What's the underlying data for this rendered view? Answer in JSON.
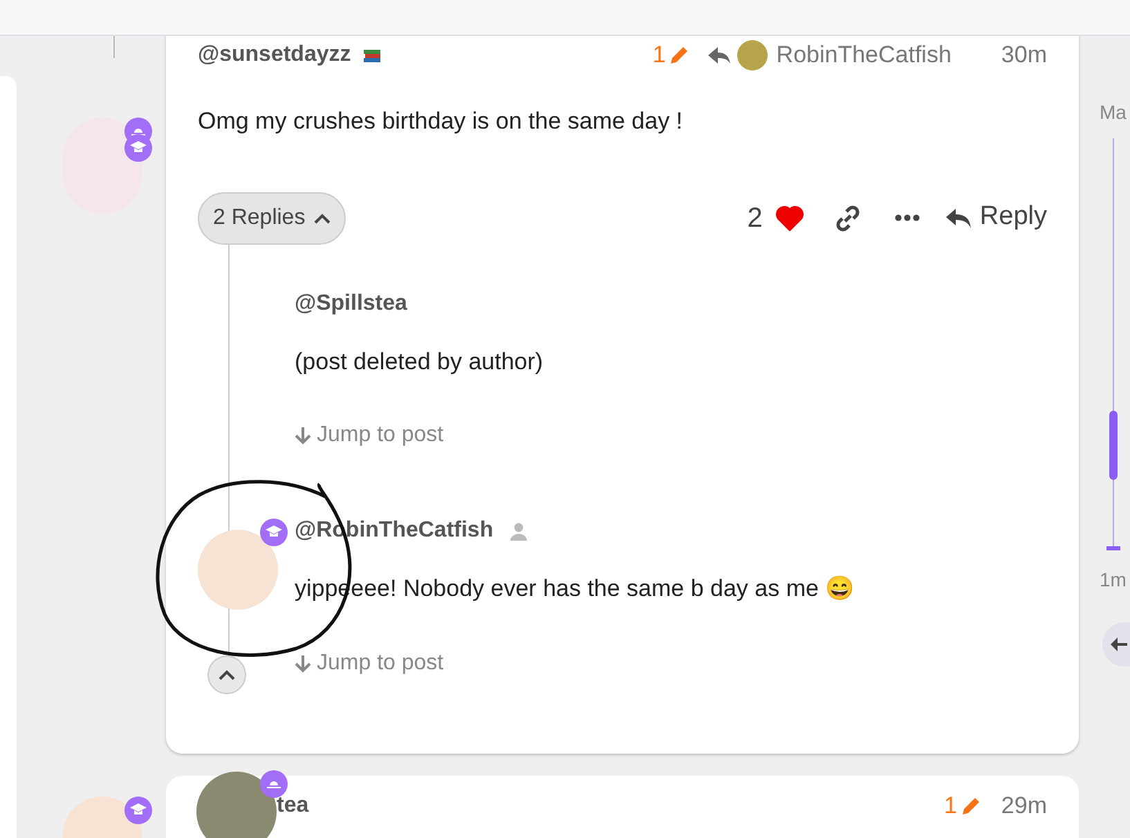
{
  "posts": [
    {
      "kind": "full",
      "author": "@sunsetdayzz",
      "edit_count": "1",
      "reply_to": "RobinTheCatfish",
      "time": "30m",
      "body": "Omg my crushes birthday is on the same day !",
      "replies_toggle": "2 Replies",
      "expanded": true,
      "like_count": "2",
      "liked": true,
      "reply_label": "Reply",
      "replies": [
        {
          "author": "@Spillstea",
          "body": "(post deleted by author)",
          "jump": "Jump to post",
          "has_avatar": false
        },
        {
          "author": "@RobinTheCatfish",
          "body": "yippeeee! Nobody ever has the same b day as me 😄",
          "jump": "Jump to post",
          "has_avatar": true
        }
      ]
    },
    {
      "kind": "partial",
      "author": "tea",
      "edit_count": "1",
      "time": "29m"
    }
  ],
  "timeline": {
    "top_label": "Ma",
    "bottom_label": "1m"
  }
}
